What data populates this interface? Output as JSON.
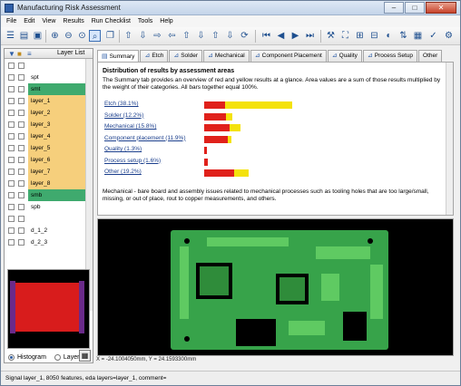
{
  "window": {
    "title": "Manufacturing Risk Assessment"
  },
  "menu": [
    "File",
    "Edit",
    "View",
    "Results",
    "Run Checklist",
    "Tools",
    "Help"
  ],
  "layer_panel": {
    "header": "Layer List",
    "layers": [
      {
        "name": "",
        "color": "#ffffff"
      },
      {
        "name": "spt",
        "color": "#ffffff"
      },
      {
        "name": "smt",
        "color": "#3faa6e"
      },
      {
        "name": "layer_1",
        "color": "#f6cf7c"
      },
      {
        "name": "layer_2",
        "color": "#f6cf7c"
      },
      {
        "name": "layer_3",
        "color": "#f6cf7c"
      },
      {
        "name": "layer_4",
        "color": "#f6cf7c"
      },
      {
        "name": "layer_5",
        "color": "#f6cf7c"
      },
      {
        "name": "layer_6",
        "color": "#f6cf7c"
      },
      {
        "name": "layer_7",
        "color": "#f6cf7c"
      },
      {
        "name": "layer_8",
        "color": "#f6cf7c"
      },
      {
        "name": "smb",
        "color": "#3faa6e"
      },
      {
        "name": "spb",
        "color": "#ffffff"
      },
      {
        "name": "",
        "color": "#ffffff"
      },
      {
        "name": "d_1_2",
        "color": "#ffffff"
      },
      {
        "name": "d_2_3",
        "color": "#ffffff"
      }
    ],
    "view_options": [
      "Histogram",
      "Layer"
    ],
    "selected_view": "Histogram"
  },
  "tabs": [
    "Summary",
    "Etch",
    "Solder",
    "Mechanical",
    "Component Placement",
    "Quality",
    "Process Setup",
    "Other"
  ],
  "active_tab": "Summary",
  "summary": {
    "heading": "Distribution of results by assessment areas",
    "description": "The Summary tab provides an overview of red and yellow results at a glance.   Area values are a sum of those results multiplied by the weight of their categories.    All bars together equal 100%.",
    "categories": [
      {
        "label": "Etch (38.1%)",
        "red": 9,
        "yellow": 29.1
      },
      {
        "label": "Solder (12.2%)",
        "red": 9.5,
        "yellow": 2.7
      },
      {
        "label": "Mechanical (15.8%)",
        "red": 11,
        "yellow": 4.8
      },
      {
        "label": "Component placement (11.9%)",
        "red": 10,
        "yellow": 1.9
      },
      {
        "label": "Quality (1.3%)",
        "red": 1.3,
        "yellow": 0
      },
      {
        "label": "Process setup (1.6%)",
        "red": 1.6,
        "yellow": 0
      },
      {
        "label": "Other (19.2%)",
        "red": 13,
        "yellow": 6.2
      }
    ],
    "footnote": "Mechanical - bare board and assembly issues related to mechanical processes such as tooling holes that are too large/small, missing, or out of place, rout to copper measurements, and others."
  },
  "coordinates": "X = -24.1004050mm, Y = 24.1593300mm",
  "status": "Signal layer_1, 8050 features, eda layers=layer_1, comment="
}
